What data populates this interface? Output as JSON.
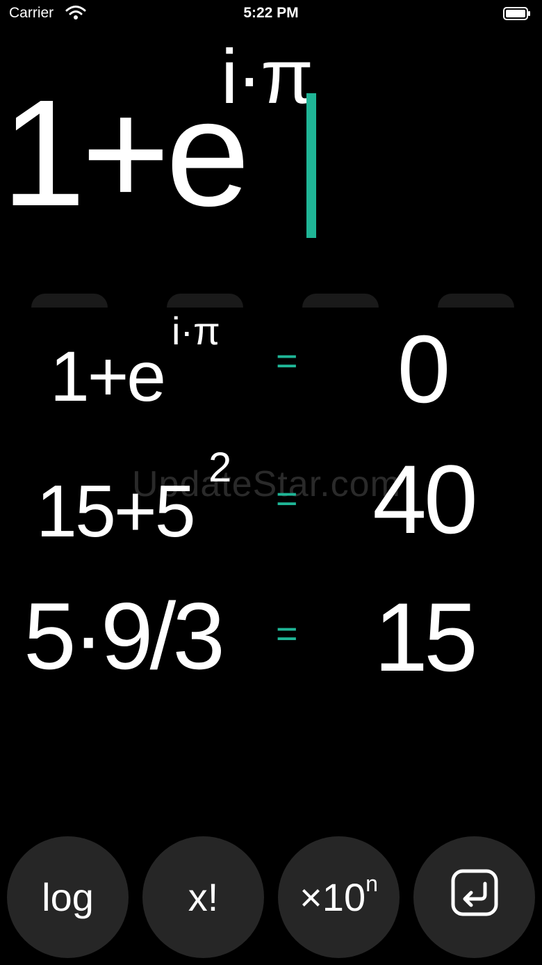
{
  "status_bar": {
    "carrier": "Carrier",
    "time": "5:22 PM"
  },
  "expression": {
    "base": "1+e",
    "exponent": "i·π",
    "cursor_color": "#1fb596"
  },
  "history": [
    {
      "base": "1+e",
      "exponent": "i·π",
      "equals": "=",
      "result": "0"
    },
    {
      "base": "15+5",
      "exponent": "2",
      "equals": "=",
      "result": "40"
    },
    {
      "base": "5·9/3",
      "exponent": "",
      "equals": "=",
      "result": "15"
    }
  ],
  "watermark": "UpdateStar.com",
  "keys": {
    "log": "log",
    "factorial": "x!",
    "sci_base": "×10",
    "sci_sup": "n",
    "enter_icon": "return-icon"
  },
  "colors": {
    "accent": "#1fb596",
    "background": "#000000",
    "key_bg": "#262626"
  }
}
